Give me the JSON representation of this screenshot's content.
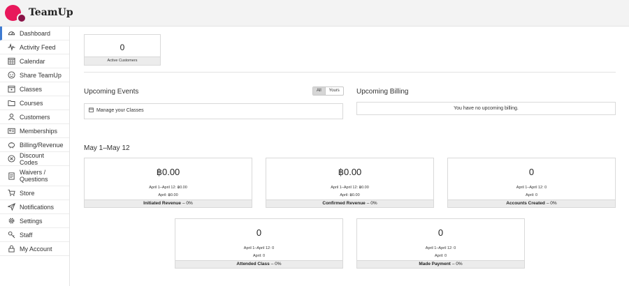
{
  "app": {
    "brand": "TeamUp"
  },
  "sidebar": {
    "items": [
      {
        "label": "Dashboard",
        "icon": "dashboard-icon",
        "active": true
      },
      {
        "label": "Activity Feed",
        "icon": "pulse-icon"
      },
      {
        "label": "Calendar",
        "icon": "calendar-icon"
      },
      {
        "label": "Share TeamUp",
        "icon": "share-icon"
      },
      {
        "label": "Classes",
        "icon": "classes-icon"
      },
      {
        "label": "Courses",
        "icon": "folder-icon"
      },
      {
        "label": "Customers",
        "icon": "user-icon"
      },
      {
        "label": "Memberships",
        "icon": "id-card-icon"
      },
      {
        "label": "Billing/Revenue",
        "icon": "piggy-bank-icon"
      },
      {
        "label": "Discount Codes",
        "icon": "discount-icon"
      },
      {
        "label": "Waivers / Questions",
        "icon": "document-icon"
      },
      {
        "label": "Store",
        "icon": "cart-icon"
      },
      {
        "label": "Notifications",
        "icon": "paper-plane-icon"
      },
      {
        "label": "Settings",
        "icon": "gear-icon"
      },
      {
        "label": "Staff",
        "icon": "key-icon"
      },
      {
        "label": "My Account",
        "icon": "lock-icon"
      }
    ]
  },
  "active_customers": {
    "value": "0",
    "label": "Active Customers"
  },
  "upcoming_events": {
    "title": "Upcoming Events",
    "toggle_all": "All",
    "toggle_yours": "Yours",
    "manage_text": "Manage your Classes"
  },
  "upcoming_billing": {
    "title": "Upcoming Billing",
    "empty_text": "You have no upcoming billing."
  },
  "stats": {
    "date_range": "May 1–May 12",
    "cards": [
      {
        "value": "฿0.00",
        "line1": "April 1–April 12: ฿0.00",
        "line2": "April: ฿0.00",
        "label": "Initiated Revenue",
        "change": "– 0%"
      },
      {
        "value": "฿0.00",
        "line1": "April 1–April 12: ฿0.00",
        "line2": "April: ฿0.00",
        "label": "Confirmed Revenue",
        "change": "– 0%"
      },
      {
        "value": "0",
        "line1": "April 1–April 12: 0",
        "line2": "April: 0",
        "label": "Accounts Created",
        "change": "– 0%"
      },
      {
        "value": "0",
        "line1": "April 1–April 12: 0",
        "line2": "April: 0",
        "label": "Attended Class",
        "change": "– 0%"
      },
      {
        "value": "0",
        "line1": "April 1–April 12: 0",
        "line2": "April: 0",
        "label": "Made Payment",
        "change": "– 0%"
      }
    ]
  },
  "colors": {
    "brand_pink": "#e8185b",
    "brand_dark": "#8a1448",
    "active_nav": "#3e7bd1"
  }
}
